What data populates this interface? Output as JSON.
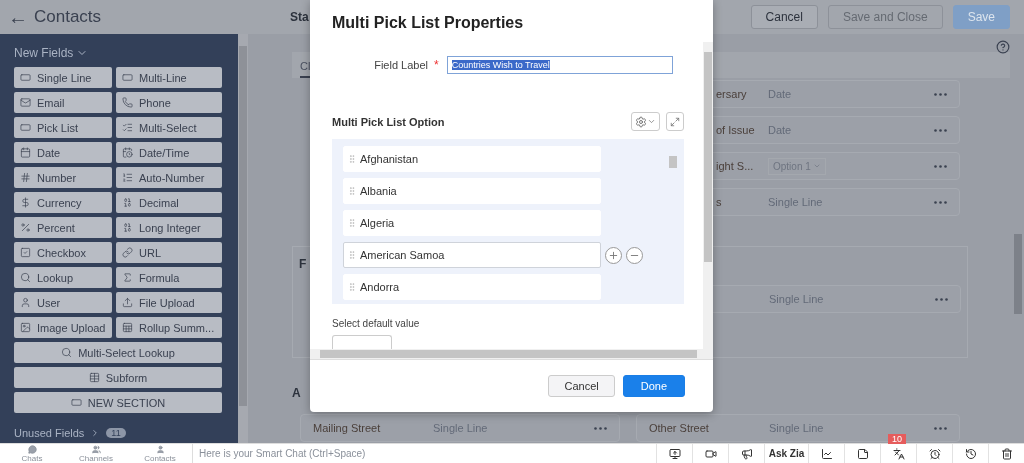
{
  "header": {
    "back_icon": "←",
    "title": "Contacts",
    "layout_title": "Sta",
    "buttons": [
      {
        "label": "Cancel",
        "kind": "secondary",
        "disabled": false
      },
      {
        "label": "Save and Close",
        "kind": "secondary",
        "disabled": true
      },
      {
        "label": "Save",
        "kind": "primary",
        "disabled": false
      }
    ]
  },
  "sidebar": {
    "heading": "New Fields",
    "expanded": true,
    "fields": [
      {
        "label": "Single Line",
        "kind": "line"
      },
      {
        "label": "Multi-Line",
        "kind": "line"
      },
      {
        "label": "Email",
        "kind": "mail"
      },
      {
        "label": "Phone",
        "kind": "phone"
      },
      {
        "label": "Pick List",
        "kind": "line"
      },
      {
        "label": "Multi-Select",
        "kind": "multi"
      },
      {
        "label": "Date",
        "kind": "date"
      },
      {
        "label": "Date/Time",
        "kind": "datetime"
      },
      {
        "label": "Number",
        "kind": "number"
      },
      {
        "label": "Auto-Number",
        "kind": "ordered"
      },
      {
        "label": "Currency",
        "kind": "currency"
      },
      {
        "label": "Decimal",
        "kind": "decimal"
      },
      {
        "label": "Percent",
        "kind": "percent"
      },
      {
        "label": "Long Integer",
        "kind": "integer"
      },
      {
        "label": "Checkbox",
        "kind": "checkbox"
      },
      {
        "label": "URL",
        "kind": "link"
      },
      {
        "label": "Lookup",
        "kind": "lookup"
      },
      {
        "label": "Formula",
        "kind": "formula"
      },
      {
        "label": "User",
        "kind": "user"
      },
      {
        "label": "File Upload",
        "kind": "upload"
      },
      {
        "label": "Image Upload",
        "kind": "image"
      },
      {
        "label": "Rollup Summ...",
        "kind": "rollup"
      }
    ],
    "wide_fields": [
      {
        "label": "Multi-Select Lookup",
        "kind": "lookup"
      },
      {
        "label": "Subform",
        "kind": "table"
      },
      {
        "label": "NEW SECTION",
        "kind": "line"
      }
    ],
    "unused": {
      "label": "Unused Fields",
      "count": "11"
    }
  },
  "canvas": {
    "tab": "Cl",
    "section_title": "F",
    "section2_title": "A",
    "right_fields": [
      {
        "label": "ersary",
        "type": "Date",
        "kind": "text"
      },
      {
        "label": "of Issue",
        "type": "Date",
        "kind": "text"
      },
      {
        "label": "ight S...",
        "type": "Option 1",
        "kind": "select"
      },
      {
        "label": "s",
        "type": "Single Line",
        "kind": "text"
      }
    ],
    "section_field": {
      "type": "Single Line"
    },
    "bottom_fields": [
      {
        "label": "Mailing Street",
        "type": "Single Line"
      },
      {
        "label": "Other Street",
        "type": "Single Line"
      }
    ]
  },
  "dialog": {
    "title": "Multi Pick List Properties",
    "field_label": {
      "label": "Field Label",
      "required_mark": "*",
      "value": "Countries Wish to Travel"
    },
    "options_title": "Multi Pick List Option",
    "options": [
      {
        "label": "Afghanistan",
        "selected": false
      },
      {
        "label": "Albania",
        "selected": false
      },
      {
        "label": "Algeria",
        "selected": false
      },
      {
        "label": "American Samoa",
        "selected": true
      },
      {
        "label": "Andorra",
        "selected": false
      }
    ],
    "default_label": "Select default value",
    "buttons": [
      {
        "label": "Cancel",
        "kind": "secondary"
      },
      {
        "label": "Done",
        "kind": "primary"
      }
    ]
  },
  "chat_bar": {
    "apps": [
      {
        "label": "Chats",
        "kind": "chat"
      },
      {
        "label": "Channels",
        "kind": "users"
      },
      {
        "label": "Contacts",
        "kind": "user"
      }
    ],
    "placeholder": "Here is your Smart Chat (Ctrl+Space)",
    "tools": [
      {
        "kind": "screen"
      },
      {
        "kind": "video"
      },
      {
        "kind": "megaphone"
      },
      {
        "kind": "text",
        "label": "Ask Zia"
      },
      {
        "kind": "chart"
      },
      {
        "kind": "note"
      },
      {
        "kind": "translate",
        "badge": "10"
      },
      {
        "kind": "alarm"
      },
      {
        "kind": "history"
      },
      {
        "kind": "trash"
      }
    ]
  }
}
